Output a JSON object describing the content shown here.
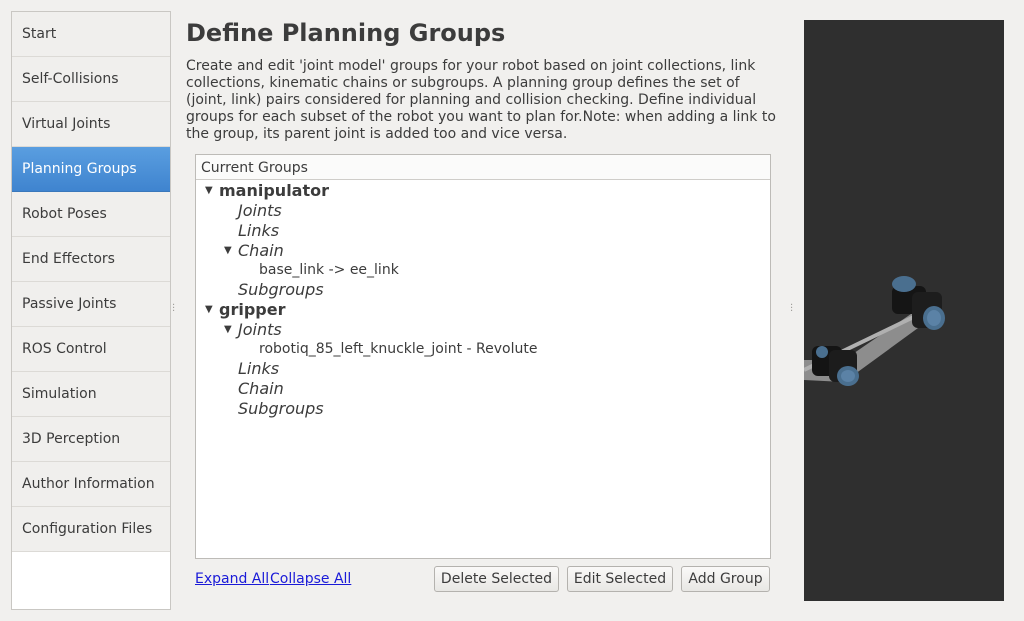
{
  "sidebar": {
    "items": [
      {
        "label": "Start"
      },
      {
        "label": "Self-Collisions"
      },
      {
        "label": "Virtual Joints"
      },
      {
        "label": "Planning Groups"
      },
      {
        "label": "Robot Poses"
      },
      {
        "label": "End Effectors"
      },
      {
        "label": "Passive Joints"
      },
      {
        "label": "ROS Control"
      },
      {
        "label": "Simulation"
      },
      {
        "label": "3D Perception"
      },
      {
        "label": "Author Information"
      },
      {
        "label": "Configuration Files"
      }
    ],
    "active_index": 3
  },
  "main": {
    "title": "Define Planning Groups",
    "description": "Create and edit 'joint model' groups for your robot based on joint collections, link collections, kinematic chains or subgroups. A planning group defines the set of (joint, link) pairs considered for planning and collision checking. Define individual groups for each subset of the robot you want to plan for.Note: when adding a link to the group, its parent joint is added too and vice versa."
  },
  "tree": {
    "header": "Current Groups",
    "group1": {
      "name": "manipulator",
      "joints": "Joints",
      "links": "Links",
      "chain": "Chain",
      "chain_value": "base_link  ->  ee_link",
      "subgroups": "Subgroups"
    },
    "group2": {
      "name": "gripper",
      "joints": "Joints",
      "joint_value": "robotiq_85_left_knuckle_joint - Revolute",
      "links": "Links",
      "chain": "Chain",
      "subgroups": "Subgroups"
    }
  },
  "actions": {
    "expand_all": "Expand All",
    "collapse_all": "Collapse All",
    "delete_selected": "Delete Selected",
    "edit_selected": "Edit Selected",
    "add_group": "Add Group"
  },
  "colors": {
    "accent": "#4a90d9",
    "link": "#1a1ad8",
    "viewport_bg": "#2f2f2f"
  }
}
